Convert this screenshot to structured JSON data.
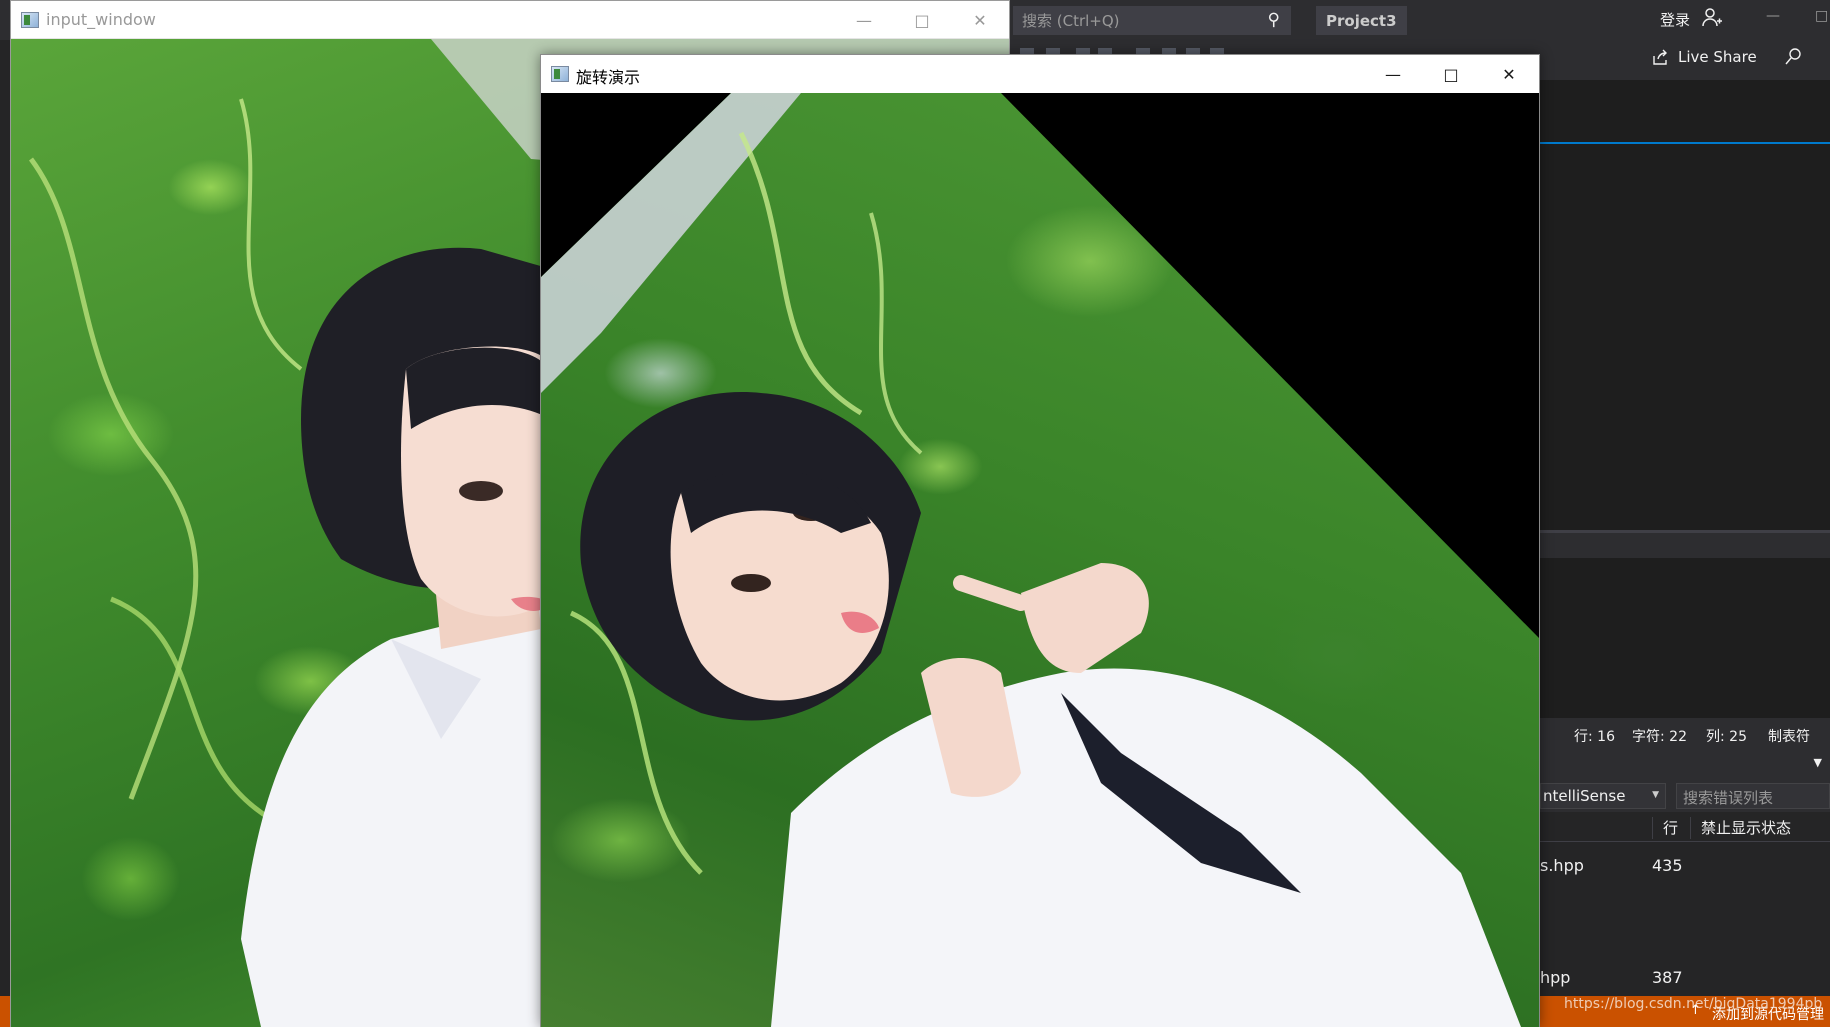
{
  "ide": {
    "search_placeholder": "搜索 (Ctrl+Q)",
    "project_name": "Project3",
    "login_label": "登录",
    "live_share_label": "Live Share",
    "status": {
      "line": "行: 16",
      "char": "字符: 22",
      "col": "列: 25",
      "tab": "制表符"
    },
    "error_filter": {
      "scope": "ntelliSense",
      "search_placeholder": "搜索错误列表"
    },
    "error_columns": {
      "line": "行",
      "suppression": "禁止显示状态"
    },
    "error_rows": [
      {
        "file": "s.hpp",
        "line": "435"
      },
      {
        "file": "hpp",
        "line": "387"
      }
    ],
    "statusbar": {
      "add_source": "添加到源代码管理",
      "watermark": "https://blog.csdn.net/bigData1994pb"
    },
    "accent_color": "#007acc",
    "status_color": "#ca5100"
  },
  "windows": {
    "input": {
      "title": "input_window"
    },
    "rotate": {
      "title": "旋转演示",
      "rotation_fill": "black"
    }
  }
}
